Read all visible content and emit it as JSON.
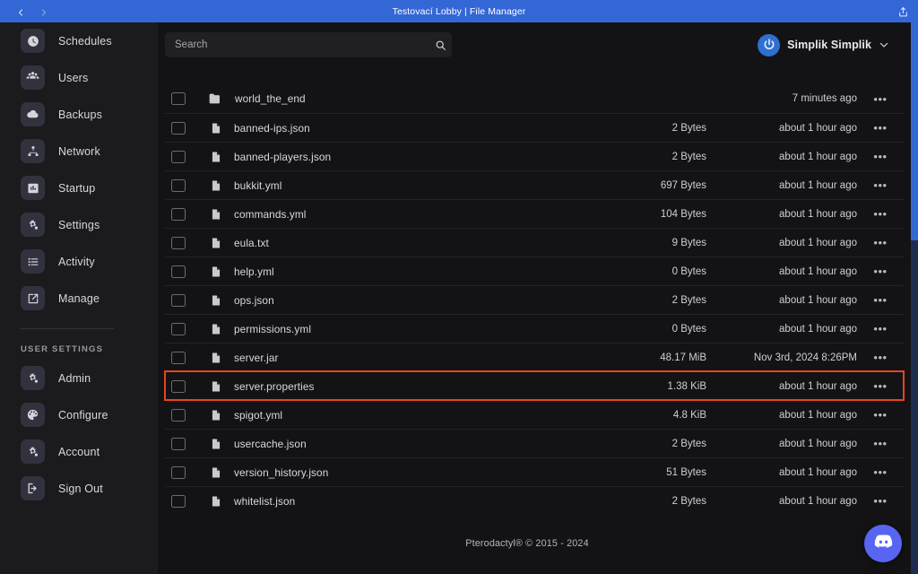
{
  "titlebar": {
    "title": "Testovací Lobby | File Manager",
    "back_icon": "chevron-left-icon",
    "forward_icon": "chevron-right-icon",
    "share_icon": "share-icon",
    "accent": "#3367d6"
  },
  "sidebar": {
    "items": [
      {
        "label": "Schedules",
        "icon": "clock-icon"
      },
      {
        "label": "Users",
        "icon": "users-icon"
      },
      {
        "label": "Backups",
        "icon": "cloud-icon"
      },
      {
        "label": "Network",
        "icon": "network-icon"
      },
      {
        "label": "Startup",
        "icon": "chart-square-icon"
      },
      {
        "label": "Settings",
        "icon": "gears-icon"
      },
      {
        "label": "Activity",
        "icon": "list-icon"
      },
      {
        "label": "Manage",
        "icon": "external-edit-icon"
      }
    ],
    "user_settings_heading": "USER SETTINGS",
    "user_items": [
      {
        "label": "Admin",
        "icon": "gears-icon"
      },
      {
        "label": "Configure",
        "icon": "palette-icon"
      },
      {
        "label": "Account",
        "icon": "gears-icon"
      },
      {
        "label": "Sign Out",
        "icon": "sign-out-icon"
      }
    ]
  },
  "search": {
    "value": "",
    "placeholder": "Search",
    "icon": "search-icon"
  },
  "user_menu": {
    "name": "Simplik Simplik",
    "avatar_icon": "power-avatar-icon",
    "chevron_icon": "chevron-down-icon",
    "avatar_color": "#2f6fd0"
  },
  "files": {
    "row_menu_glyph": "•••",
    "highlight_color": "#e8441f",
    "rows": [
      {
        "name": "world_the_end",
        "icon": "folder-icon",
        "type": "directory",
        "size": "",
        "modified": "7 minutes ago",
        "highlighted": false
      },
      {
        "name": "banned-ips.json",
        "icon": "file-icon",
        "type": "file",
        "size": "2 Bytes",
        "modified": "about 1 hour ago",
        "highlighted": false
      },
      {
        "name": "banned-players.json",
        "icon": "file-icon",
        "type": "file",
        "size": "2 Bytes",
        "modified": "about 1 hour ago",
        "highlighted": false
      },
      {
        "name": "bukkit.yml",
        "icon": "file-icon",
        "type": "file",
        "size": "697 Bytes",
        "modified": "about 1 hour ago",
        "highlighted": false
      },
      {
        "name": "commands.yml",
        "icon": "file-icon",
        "type": "file",
        "size": "104 Bytes",
        "modified": "about 1 hour ago",
        "highlighted": false
      },
      {
        "name": "eula.txt",
        "icon": "file-icon",
        "type": "file",
        "size": "9 Bytes",
        "modified": "about 1 hour ago",
        "highlighted": false
      },
      {
        "name": "help.yml",
        "icon": "file-icon",
        "type": "file",
        "size": "0 Bytes",
        "modified": "about 1 hour ago",
        "highlighted": false
      },
      {
        "name": "ops.json",
        "icon": "file-icon",
        "type": "file",
        "size": "2 Bytes",
        "modified": "about 1 hour ago",
        "highlighted": false
      },
      {
        "name": "permissions.yml",
        "icon": "file-icon",
        "type": "file",
        "size": "0 Bytes",
        "modified": "about 1 hour ago",
        "highlighted": false
      },
      {
        "name": "server.jar",
        "icon": "file-icon",
        "type": "file",
        "size": "48.17 MiB",
        "modified": "Nov 3rd, 2024 8:26PM",
        "highlighted": false
      },
      {
        "name": "server.properties",
        "icon": "file-icon",
        "type": "file",
        "size": "1.38 KiB",
        "modified": "about 1 hour ago",
        "highlighted": true
      },
      {
        "name": "spigot.yml",
        "icon": "file-icon",
        "type": "file",
        "size": "4.8 KiB",
        "modified": "about 1 hour ago",
        "highlighted": false
      },
      {
        "name": "usercache.json",
        "icon": "file-icon",
        "type": "file",
        "size": "2 Bytes",
        "modified": "about 1 hour ago",
        "highlighted": false
      },
      {
        "name": "version_history.json",
        "icon": "file-icon",
        "type": "file",
        "size": "51 Bytes",
        "modified": "about 1 hour ago",
        "highlighted": false
      },
      {
        "name": "whitelist.json",
        "icon": "file-icon",
        "type": "file",
        "size": "2 Bytes",
        "modified": "about 1 hour ago",
        "highlighted": false
      }
    ]
  },
  "footer": {
    "text": "Pterodactyl® © 2015 - 2024"
  },
  "discord": {
    "icon": "discord-icon",
    "color": "#5865f2"
  }
}
